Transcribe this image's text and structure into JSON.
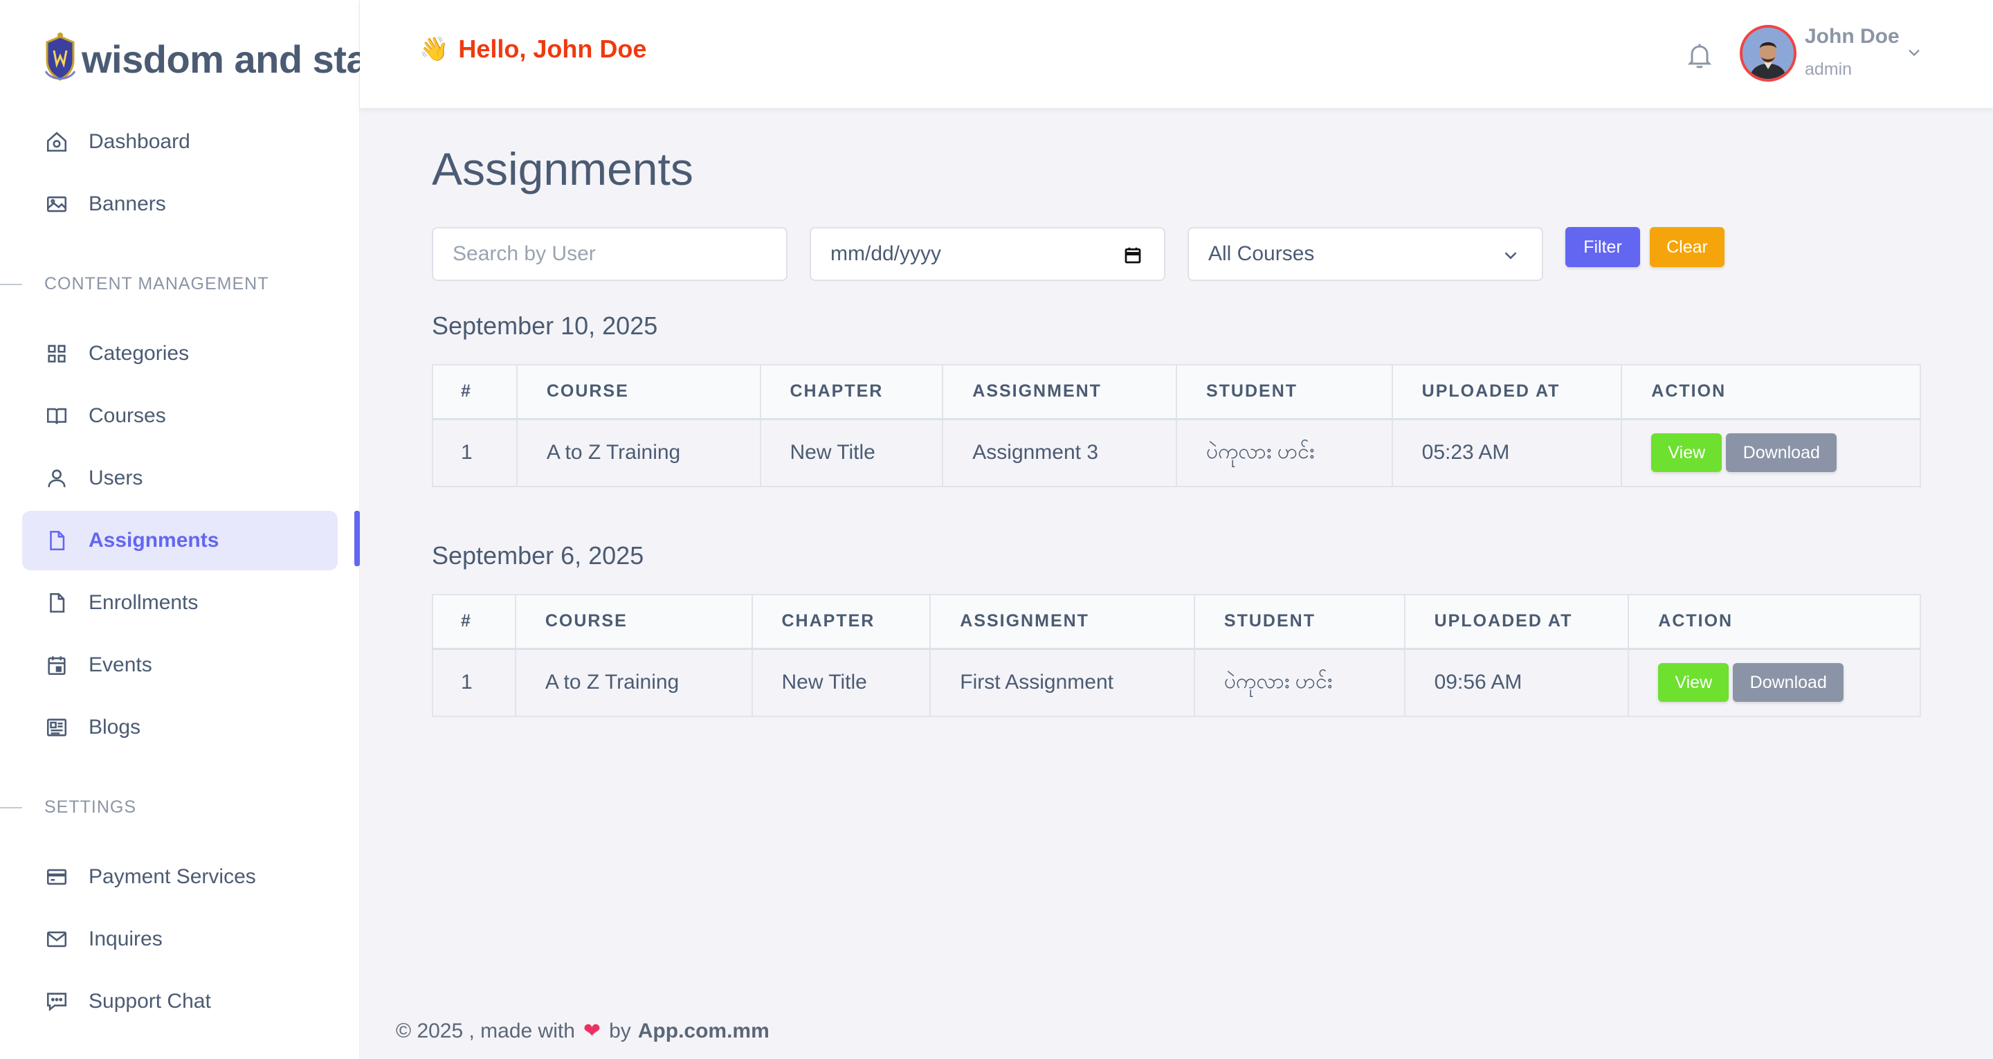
{
  "brand": {
    "name": "wisdom and stal"
  },
  "sidebar": {
    "items_top": [
      {
        "label": "Dashboard",
        "icon": "home-icon"
      },
      {
        "label": "Banners",
        "icon": "image-icon"
      }
    ],
    "section_content": "CONTENT MANAGEMENT",
    "items_content": [
      {
        "label": "Categories",
        "icon": "grid-icon"
      },
      {
        "label": "Courses",
        "icon": "book-icon"
      },
      {
        "label": "Users",
        "icon": "user-icon"
      },
      {
        "label": "Assignments",
        "icon": "file-icon",
        "active": true
      },
      {
        "label": "Enrollments",
        "icon": "file-icon"
      },
      {
        "label": "Events",
        "icon": "calendar-icon"
      },
      {
        "label": "Blogs",
        "icon": "newspaper-icon"
      }
    ],
    "section_settings": "SETTINGS",
    "items_settings": [
      {
        "label": "Payment Services",
        "icon": "credit-card-icon"
      },
      {
        "label": "Inquires",
        "icon": "mail-icon"
      },
      {
        "label": "Support Chat",
        "icon": "chat-icon"
      }
    ]
  },
  "header": {
    "greeting": "Hello, John Doe",
    "wave": "👋",
    "user_name": "John Doe",
    "user_role": "admin"
  },
  "page": {
    "title": "Assignments",
    "filters": {
      "search_placeholder": "Search by User",
      "date_placeholder": "mm/dd/yyyy",
      "course_selected": "All Courses",
      "filter_label": "Filter",
      "clear_label": "Clear"
    },
    "columns": [
      "#",
      "COURSE",
      "CHAPTER",
      "ASSIGNMENT",
      "STUDENT",
      "UPLOADED AT",
      "ACTION"
    ],
    "view_label": "View",
    "download_label": "Download",
    "groups": [
      {
        "date": "September 10, 2025",
        "rows": [
          {
            "num": "1",
            "course": "A to Z Training",
            "chapter": "New Title",
            "assignment": "Assignment 3",
            "student": "ပဲကုလား ဟင်း",
            "uploaded": "05:23 AM"
          }
        ]
      },
      {
        "date": "September 6, 2025",
        "rows": [
          {
            "num": "1",
            "course": "A to Z Training",
            "chapter": "New Title",
            "assignment": "First Assignment",
            "student": "ပဲကုလား ဟင်း",
            "uploaded": "09:56 AM"
          }
        ]
      }
    ]
  },
  "footer": {
    "prefix": "© 2025 , made with",
    "by": "by",
    "brand": "App.com.mm"
  },
  "colors": {
    "accent": "#6366f1",
    "greeting": "#f0390f",
    "filter_btn": "#6366f1",
    "clear_btn": "#f59e0b",
    "view_btn": "#6ee02f",
    "download_btn": "#8a94a6"
  }
}
